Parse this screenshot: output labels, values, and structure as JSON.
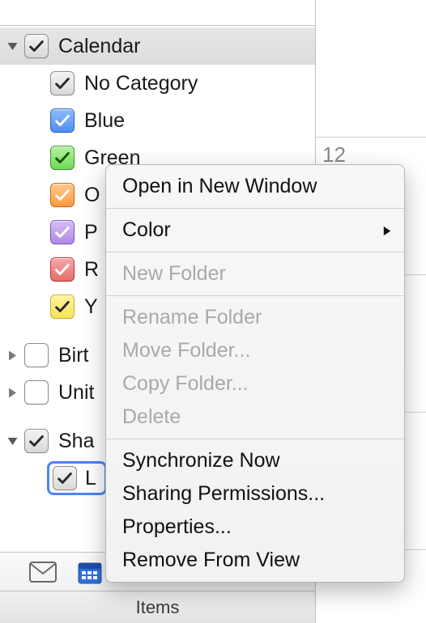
{
  "sidebar": {
    "heading": "Calendar",
    "categories": [
      {
        "label": "No Category",
        "color": "gray"
      },
      {
        "label": "Blue",
        "color": "blue"
      },
      {
        "label": "Green",
        "color": "green"
      },
      {
        "label": "O",
        "color": "orange"
      },
      {
        "label": "P",
        "color": "purple"
      },
      {
        "label": "R",
        "color": "red"
      },
      {
        "label": "Y",
        "color": "yellow"
      }
    ],
    "groups": [
      {
        "label": "Birt",
        "checked": false,
        "expanded": false
      },
      {
        "label": "Unit",
        "checked": false,
        "expanded": false
      }
    ],
    "shared": {
      "label": "Sha",
      "item_label": "L"
    }
  },
  "status_bar": {
    "text": "Items"
  },
  "calendar_strip": {
    "day": "12"
  },
  "context_menu": {
    "open_new_window": "Open in New Window",
    "color": "Color",
    "new_folder": "New Folder",
    "rename_folder": "Rename Folder",
    "move_folder": "Move Folder...",
    "copy_folder": "Copy Folder...",
    "delete": "Delete",
    "sync_now": "Synchronize Now",
    "sharing_permissions": "Sharing Permissions...",
    "properties": "Properties...",
    "remove_from_view": "Remove From View"
  }
}
